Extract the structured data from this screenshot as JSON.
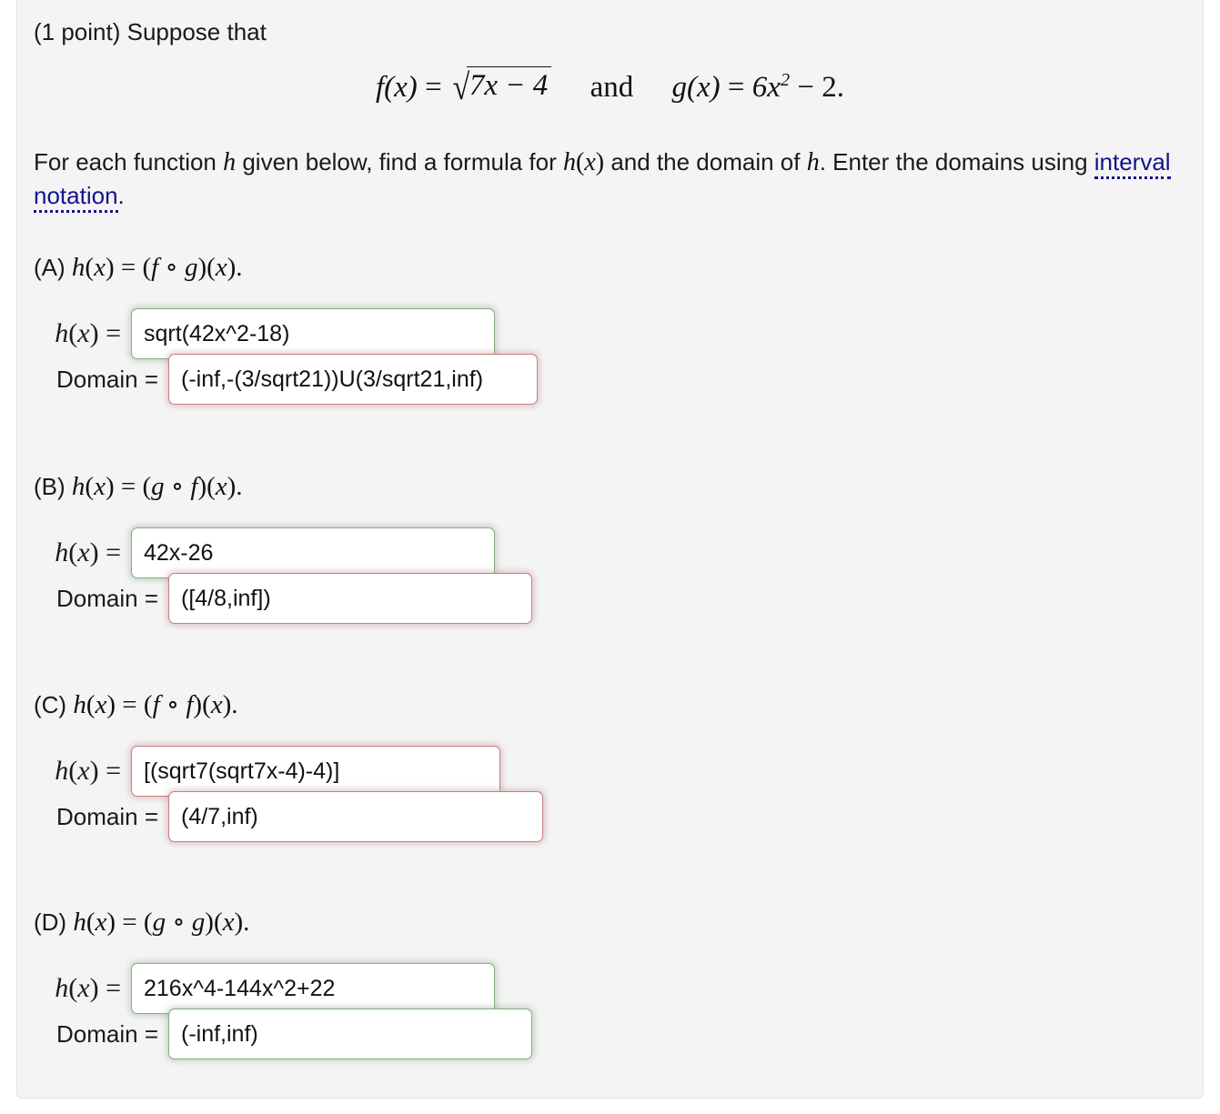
{
  "problem": {
    "points_label": "(1 point) Suppose that",
    "equation": {
      "f_name": "f",
      "f_arg": "(x)",
      "equals": "=",
      "f_radicand": "7x − 4",
      "conjunction": "and",
      "g_name": "g",
      "g_arg": "(x)",
      "g_body": "6x",
      "g_exponent": "2",
      "g_tail": "− 2."
    },
    "instructions": {
      "before_link": "For each function h given below, find a formula for h(x) and the domain of h. Enter the domains using ",
      "link_text": "interval notation",
      "after_link": "."
    }
  },
  "parts": [
    {
      "id": "A",
      "label": "(A) h(x) = (f ∘ g)(x).",
      "label_prefix": "(A)",
      "composition_left": "f",
      "composition_right": "g",
      "hx_label": "h(x) =",
      "hx_value": "sqrt(42x^2-18)",
      "hx_status": "correct",
      "domain_label": "Domain =",
      "domain_value": "(-inf,-(3/sqrt21))U(3/sqrt21,inf)",
      "domain_status": "incorrect"
    },
    {
      "id": "B",
      "label": "(B) h(x) = (g ∘ f)(x).",
      "label_prefix": "(B)",
      "composition_left": "g",
      "composition_right": "f",
      "hx_label": "h(x) =",
      "hx_value": "42x-26",
      "hx_status": "correct",
      "domain_label": "Domain =",
      "domain_value": "([4/8,inf])",
      "domain_status": "incorrect"
    },
    {
      "id": "C",
      "label": "(C) h(x) = (f ∘ f)(x).",
      "label_prefix": "(C)",
      "composition_left": "f",
      "composition_right": "f",
      "hx_label": "h(x) =",
      "hx_value": "[(sqrt7(sqrt7x-4)-4)]",
      "hx_status": "incorrect",
      "domain_label": "Domain =",
      "domain_value": "(4/7,inf)",
      "domain_status": "incorrect"
    },
    {
      "id": "D",
      "label": "(D) h(x) = (g ∘ g)(x).",
      "label_prefix": "(D)",
      "composition_left": "g",
      "composition_right": "g",
      "hx_label": "h(x) =",
      "hx_value": "216x^4-144x^2+22",
      "hx_status": "correct",
      "domain_label": "Domain =",
      "domain_value": "(-inf,inf)",
      "domain_status": "correct"
    }
  ],
  "colors": {
    "page_background": "#ffffff",
    "panel_background": "#f4f4f4",
    "panel_border": "#e2e2e2",
    "text": "#1a1a1a",
    "link": "#12138f",
    "correct_border": "#87ab84",
    "incorrect_border": "#c28183",
    "input_background": "#ffffff"
  }
}
